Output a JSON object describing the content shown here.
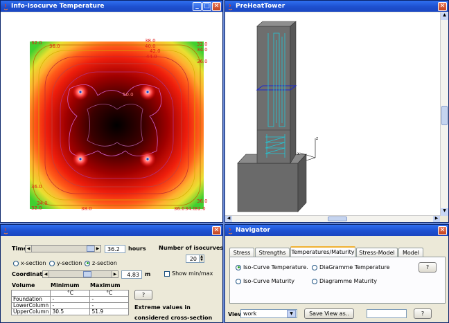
{
  "windows": {
    "isocurve": {
      "title": "Info-Isocurve Temperature"
    },
    "tower": {
      "title": "PreHeatTower"
    },
    "controls": {
      "title": ""
    },
    "navigator": {
      "title": "Navigator"
    }
  },
  "isocurve_labels": [
    "32.0",
    "36.0",
    "38.0",
    "40.0",
    "42.0",
    "44.0",
    "32.0",
    "34.0",
    "36.0",
    "36.0",
    "50.0",
    "36.0",
    "34.0",
    "32.0",
    "38.0",
    "36.0",
    "34.0",
    "32.0"
  ],
  "controls": {
    "time_label": "Time",
    "time_value": "36.2",
    "time_unit": "hours",
    "num_isocurves_label": "Number of isocurves",
    "num_isocurves_value": "20",
    "sections": [
      {
        "label": "x-section",
        "selected": false
      },
      {
        "label": "y-section",
        "selected": false
      },
      {
        "label": "z-section",
        "selected": true
      }
    ],
    "coordinate_label": "Coordinate",
    "coordinate_value": "4.83",
    "coordinate_unit": "m",
    "show_minmax_label": "Show min/max",
    "table_headers": [
      "Volume",
      "Minimum",
      "Maximum"
    ],
    "table_rows": [
      [
        "",
        "°C",
        "°C"
      ],
      [
        "Foundation",
        "-",
        "-"
      ],
      [
        "LowerColumn",
        "-",
        "-"
      ],
      [
        "UpperColumn",
        "30.5",
        "51.9"
      ]
    ],
    "help_label": "?",
    "extreme_line1": "Extreme values in",
    "extreme_line2": "considered cross-section"
  },
  "navigator": {
    "tabs": [
      "Stress",
      "Strengths",
      "Temperatures/Maturity",
      "Stress-Model",
      "Model"
    ],
    "active_tab": 2,
    "options": [
      {
        "label": "Iso-Curve Temperature.",
        "selected": true
      },
      {
        "label": "DiaGramme Temperature",
        "selected": false
      },
      {
        "label": "Iso-Curve Maturity",
        "selected": false
      },
      {
        "label": "Diagramme Maturity",
        "selected": false
      }
    ],
    "help_label": "?",
    "view_label": "View",
    "view_value": "work",
    "save_view_label": "Save View as..",
    "save_name_value": "",
    "help2_label": "?"
  },
  "colors": {
    "title_blue": "#1e50d0",
    "iso_label_red": "#e01818",
    "tower_grey": "#666666",
    "rebar_cyan": "#22c8d8"
  }
}
